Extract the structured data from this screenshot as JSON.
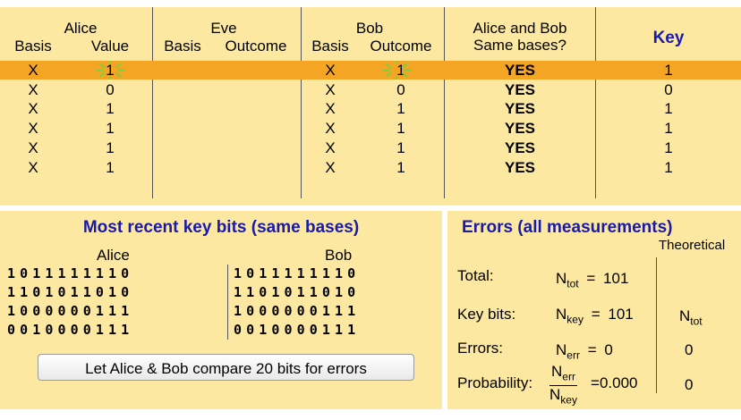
{
  "table": {
    "headers": {
      "alice": "Alice",
      "eve": "Eve",
      "bob": "Bob",
      "alice_bob_same": [
        "Alice and Bob",
        "Same bases?"
      ],
      "key": "Key",
      "basis": "Basis",
      "value": "Value",
      "outcome": "Outcome"
    },
    "rows": [
      {
        "alice_basis": "X",
        "alice_value": "1",
        "eve_basis": "",
        "eve_outcome": "",
        "bob_basis": "X",
        "bob_outcome": "1",
        "same": "YES",
        "key": "1",
        "highlight": true
      },
      {
        "alice_basis": "X",
        "alice_value": "0",
        "eve_basis": "",
        "eve_outcome": "",
        "bob_basis": "X",
        "bob_outcome": "0",
        "same": "YES",
        "key": "0",
        "highlight": false
      },
      {
        "alice_basis": "X",
        "alice_value": "1",
        "eve_basis": "",
        "eve_outcome": "",
        "bob_basis": "X",
        "bob_outcome": "1",
        "same": "YES",
        "key": "1",
        "highlight": false
      },
      {
        "alice_basis": "X",
        "alice_value": "1",
        "eve_basis": "",
        "eve_outcome": "",
        "bob_basis": "X",
        "bob_outcome": "1",
        "same": "YES",
        "key": "1",
        "highlight": false
      },
      {
        "alice_basis": "X",
        "alice_value": "1",
        "eve_basis": "",
        "eve_outcome": "",
        "bob_basis": "X",
        "bob_outcome": "1",
        "same": "YES",
        "key": "1",
        "highlight": false
      },
      {
        "alice_basis": "X",
        "alice_value": "1",
        "eve_basis": "",
        "eve_outcome": "",
        "bob_basis": "X",
        "bob_outcome": "1",
        "same": "YES",
        "key": "1",
        "highlight": false
      }
    ]
  },
  "key_bits": {
    "title": "Most recent key bits (same bases)",
    "alice_label": "Alice",
    "bob_label": "Bob",
    "alice_rows": [
      "1011111110",
      "1101011010",
      "1000000111",
      "0010000111"
    ],
    "bob_rows": [
      "1011111110",
      "1101011010",
      "1000000111",
      "0010000111"
    ],
    "compare_button": "Let Alice & Bob compare 20 bits for errors"
  },
  "errors": {
    "title": "Errors (all measurements)",
    "theoretical_label": "Theoretical",
    "total_label": "Total:",
    "total_value": "101",
    "key_bits_label": "Key bits:",
    "key_bits_value": "101",
    "errors_label": "Errors:",
    "errors_value": "0",
    "probability_label": "Probability:",
    "probability_value": "0.000",
    "theoretical_key_bits": "N",
    "theoretical_key_bits_sub": "tot",
    "theoretical_errors": "0",
    "theoretical_probability": "0",
    "n_symbol": "N",
    "sub_tot": "tot",
    "sub_key": "key",
    "sub_err": "err",
    "equals": "="
  },
  "colors": {
    "panel_bg": "#fde8a2",
    "highlight_row": "#f5a524",
    "title_blue": "#1a1aa6",
    "spark_green": "#7ad13a"
  }
}
